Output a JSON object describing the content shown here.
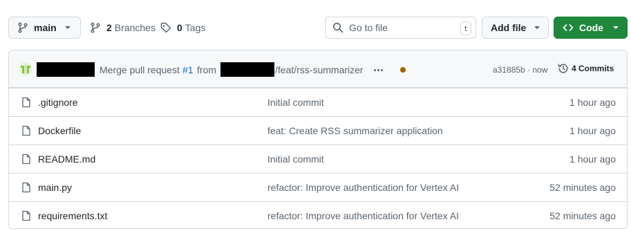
{
  "branch": {
    "name": "main"
  },
  "branches": {
    "count": "2",
    "label": "Branches"
  },
  "tags": {
    "count": "0",
    "label": "Tags"
  },
  "search": {
    "placeholder": "Go to file",
    "shortcut": "t"
  },
  "add_file": {
    "label": "Add file"
  },
  "code_button": {
    "label": "Code",
    "color": "#1f883d"
  },
  "latest_commit": {
    "message_prefix": "Merge pull request",
    "pr_number": "#1",
    "message_from": "from",
    "message_suffix": "/feat/rss-summarizer",
    "sha": "a31885b · now",
    "status_color": "#9a6700",
    "commits_count": "4 Commits"
  },
  "files": [
    {
      "name": ".gitignore",
      "message": "Initial commit",
      "time": "1 hour ago"
    },
    {
      "name": "Dockerfile",
      "message": "feat: Create RSS summarizer application",
      "time": "1 hour ago"
    },
    {
      "name": "README.md",
      "message": "Initial commit",
      "time": "1 hour ago"
    },
    {
      "name": "main.py",
      "message": "refactor: Improve authentication for Vertex AI",
      "time": "52 minutes ago"
    },
    {
      "name": "requirements.txt",
      "message": "refactor: Improve authentication for Vertex AI",
      "time": "52 minutes ago"
    }
  ]
}
